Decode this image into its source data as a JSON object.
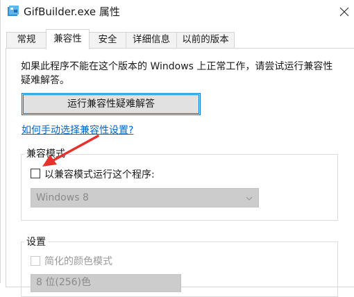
{
  "window": {
    "title": "GifBuilder.exe 属性"
  },
  "tabs": [
    {
      "label": "常规",
      "active": false
    },
    {
      "label": "兼容性",
      "active": true
    },
    {
      "label": "安全",
      "active": false
    },
    {
      "label": "详细信息",
      "active": false
    },
    {
      "label": "以前的版本",
      "active": false
    }
  ],
  "compat": {
    "intro_line1": "如果此程序不能在这个版本的 Windows 上正常工作，请尝试运行兼容性",
    "intro_line2": "疑难解答。",
    "run_troubleshooter_label": "运行兼容性疑难解答",
    "manual_link": "如何手动选择兼容性设置?",
    "mode_group": {
      "legend": "兼容模式",
      "checkbox_label": "以兼容模式运行这个程序:",
      "checked": false,
      "os_selected": "Windows 8"
    },
    "settings_group": {
      "legend": "设置",
      "reduced_color_label": "简化的颜色模式",
      "color_depth_selected": "8 位(256)色"
    }
  },
  "colors": {
    "accent": "#0078d7",
    "link": "#0066cc",
    "annotation_arrow": "#e5322d"
  },
  "icons": {
    "app": "gifbuilder-app-icon",
    "close": "close-icon",
    "dropdown": "chevron-down-icon"
  }
}
